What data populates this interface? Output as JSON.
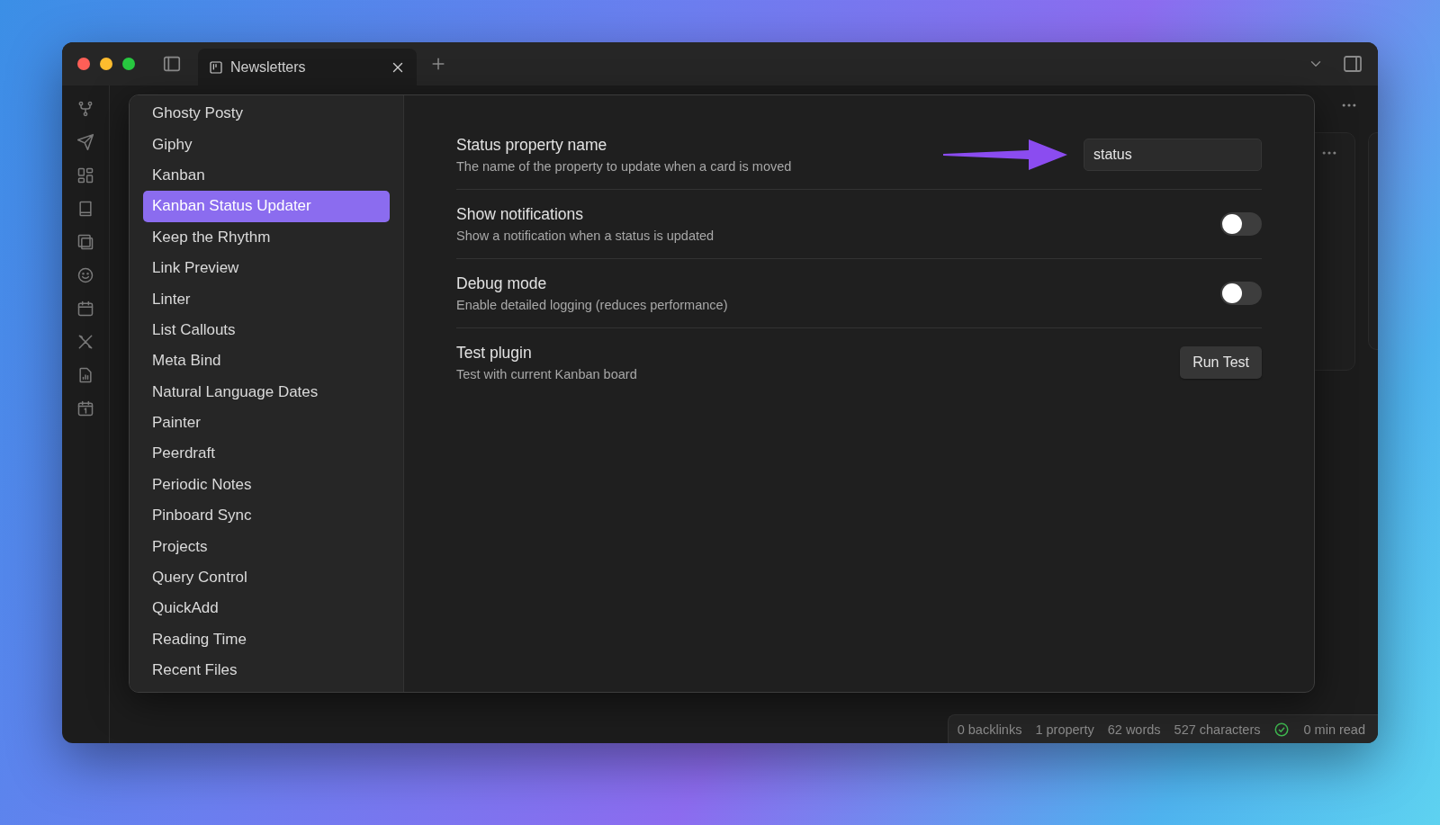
{
  "tab": {
    "title": "Newsletters"
  },
  "plugins": [
    {
      "label": "Ghosty Posty",
      "selected": false
    },
    {
      "label": "Giphy",
      "selected": false
    },
    {
      "label": "Kanban",
      "selected": false
    },
    {
      "label": "Kanban Status Updater",
      "selected": true
    },
    {
      "label": "Keep the Rhythm",
      "selected": false
    },
    {
      "label": "Link Preview",
      "selected": false
    },
    {
      "label": "Linter",
      "selected": false
    },
    {
      "label": "List Callouts",
      "selected": false
    },
    {
      "label": "Meta Bind",
      "selected": false
    },
    {
      "label": "Natural Language Dates",
      "selected": false
    },
    {
      "label": "Painter",
      "selected": false
    },
    {
      "label": "Peerdraft",
      "selected": false
    },
    {
      "label": "Periodic Notes",
      "selected": false
    },
    {
      "label": "Pinboard Sync",
      "selected": false
    },
    {
      "label": "Projects",
      "selected": false
    },
    {
      "label": "Query Control",
      "selected": false
    },
    {
      "label": "QuickAdd",
      "selected": false
    },
    {
      "label": "Reading Time",
      "selected": false
    },
    {
      "label": "Recent Files",
      "selected": false
    }
  ],
  "settings": [
    {
      "kind": "text",
      "name": "Status property name",
      "description": "The name of the property to update when a card is moved",
      "value": "status"
    },
    {
      "kind": "toggle",
      "name": "Show notifications",
      "description": "Show a notification when a status is updated",
      "on": false
    },
    {
      "kind": "toggle",
      "name": "Debug mode",
      "description": "Enable detailed logging (reduces performance)",
      "on": false
    },
    {
      "kind": "button",
      "name": "Test plugin",
      "description": "Test with current Kanban board",
      "button": "Run Test"
    }
  ],
  "status_bar": {
    "items": [
      "0 backlinks",
      "1 property",
      "62 words",
      "527 characters"
    ],
    "sync_ok": true,
    "read_time": "0 min read"
  }
}
